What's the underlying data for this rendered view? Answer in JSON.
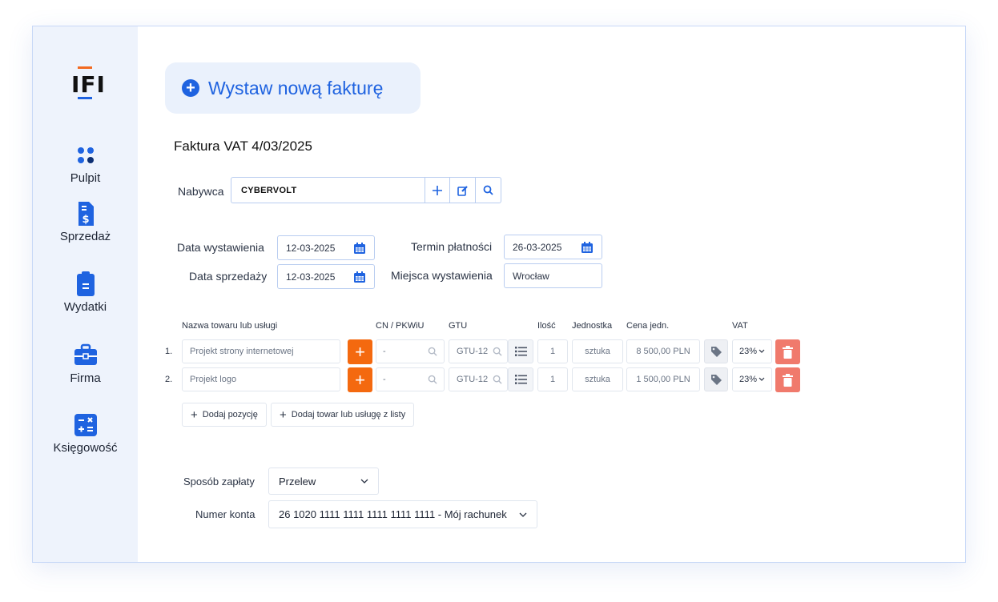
{
  "brand": {
    "logo_text": "IFI",
    "accent": "#1f63e0",
    "orange": "#f4690f"
  },
  "sidebar": {
    "items": [
      {
        "label": "Pulpit",
        "icon": "dashboard-dots-icon"
      },
      {
        "label": "Sprzedaż",
        "icon": "invoice-dollar-icon"
      },
      {
        "label": "Wydatki",
        "icon": "clipboard-icon"
      },
      {
        "label": "Firma",
        "icon": "briefcase-icon"
      },
      {
        "label": "Księgowość",
        "icon": "calculator-icon"
      }
    ]
  },
  "header": {
    "new_invoice_label": "Wystaw nową fakturę"
  },
  "invoice": {
    "title": "Faktura VAT 4/03/2025",
    "buyer_label": "Nabywca",
    "buyer_value": "CYBERVOLT",
    "issue_date_label": "Data wystawienia",
    "issue_date": "12-03-2025",
    "sale_date_label": "Data sprzedaży",
    "sale_date": "12-03-2025",
    "due_date_label": "Termin płatności",
    "due_date": "26-03-2025",
    "place_label": "Miejsca wystawienia",
    "place_value": "Wrocław"
  },
  "items_table": {
    "headers": [
      "Nazwa towaru lub usługi",
      "CN / PKWiU",
      "GTU",
      "Ilość",
      "Jednostka",
      "Cena jedn.",
      "VAT"
    ],
    "rows": [
      {
        "num": "1.",
        "name": "Projekt strony internetowej",
        "cn": "-",
        "gtu": "GTU-12",
        "qty": "1",
        "unit": "sztuka",
        "price": "8 500,00 PLN",
        "vat": "23%"
      },
      {
        "num": "2.",
        "name": "Projekt logo",
        "cn": "-",
        "gtu": "GTU-12",
        "qty": "1",
        "unit": "sztuka",
        "price": "1 500,00 PLN",
        "vat": "23%"
      }
    ],
    "add_position_label": "Dodaj pozycję",
    "add_from_list_label": "Dodaj towar lub usługę z listy"
  },
  "payment": {
    "method_label": "Sposób zapłaty",
    "method_value": "Przelew",
    "account_label": "Numer konta",
    "account_value": "26 1020 1111 1111 1111 1111 1111 - Mój rachunek"
  }
}
